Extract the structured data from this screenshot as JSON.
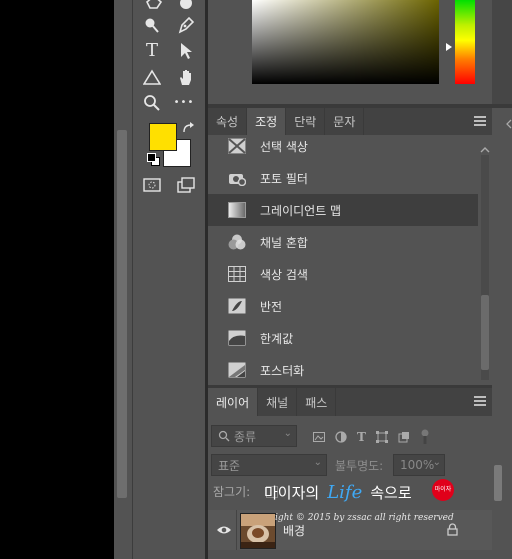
{
  "colors": {
    "foreground": "#ffe000",
    "background": "#ffffff",
    "panel": "#535353",
    "selected_item": "#3e3e3e"
  },
  "toolbar": {
    "tools": [
      {
        "name": "polygon-icon"
      },
      {
        "name": "blob-icon"
      },
      {
        "name": "brush-icon"
      },
      {
        "name": "pen-icon"
      },
      {
        "name": "type-tool-icon",
        "glyph": "T"
      },
      {
        "name": "path-select-icon"
      },
      {
        "name": "triangle-shape-icon"
      },
      {
        "name": "hand-icon"
      },
      {
        "name": "zoom-icon"
      },
      {
        "name": "more-icon",
        "glyph": "•••"
      },
      {
        "name": "quick-mask-icon"
      },
      {
        "name": "screen-mode-icon"
      }
    ]
  },
  "adjustments_panel": {
    "tabs": [
      {
        "label": "속성",
        "active": false
      },
      {
        "label": "조정",
        "active": true
      },
      {
        "label": "단락",
        "active": false
      },
      {
        "label": "문자",
        "active": false
      }
    ],
    "items": [
      {
        "label": "선택 색상",
        "icon": "selective-color-icon"
      },
      {
        "label": "포토 필터",
        "icon": "photo-filter-icon"
      },
      {
        "label": "그레이디언트 맵",
        "icon": "gradient-map-icon",
        "selected": true
      },
      {
        "label": "채널 혼합",
        "icon": "channel-mixer-icon"
      },
      {
        "label": "색상 검색",
        "icon": "color-lookup-icon"
      },
      {
        "label": "반전",
        "icon": "invert-icon"
      },
      {
        "label": "한계값",
        "icon": "threshold-icon"
      },
      {
        "label": "포스터화",
        "icon": "posterize-icon"
      }
    ]
  },
  "layers_panel": {
    "tabs": [
      {
        "label": "레이어",
        "active": true
      },
      {
        "label": "채널",
        "active": false
      },
      {
        "label": "패스",
        "active": false
      }
    ],
    "filter_kind": "종류",
    "blend_mode": "표준",
    "opacity_label": "불투명도:",
    "opacity_value": "100%",
    "lock_label": "잠그기:",
    "layers": [
      {
        "name": "배경",
        "visible": true,
        "locked": true
      }
    ]
  },
  "watermark": {
    "line1_a": "마이자의",
    "line1_b": "Life",
    "line1_c": "속으로",
    "stamp": "마이자",
    "line2": "ight © 2015 by zssac all right reserved"
  }
}
